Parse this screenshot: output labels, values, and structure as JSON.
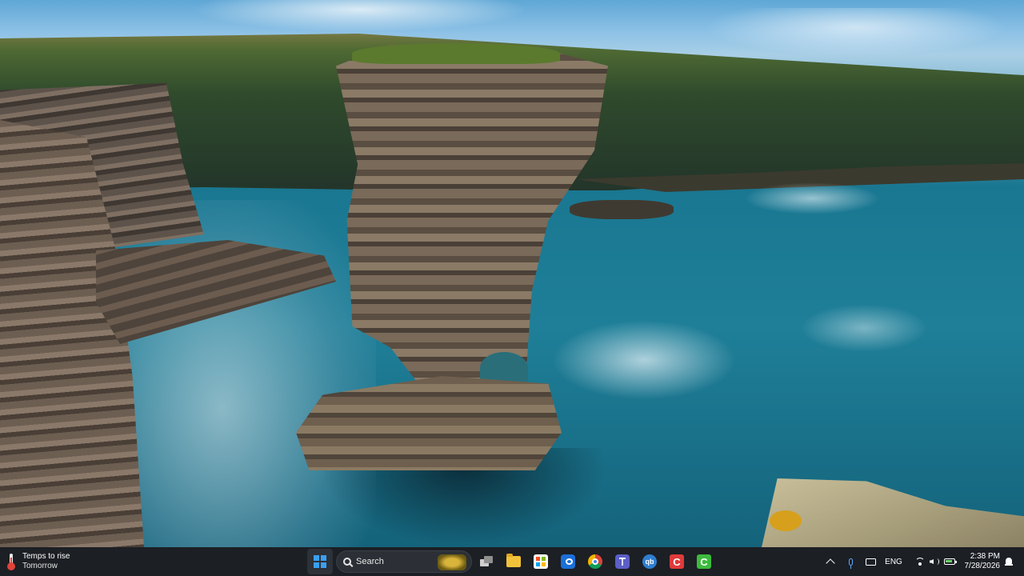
{
  "taskbar": {
    "weather": {
      "line1": "Temps to rise",
      "line2": "Tomorrow"
    },
    "search": {
      "label": "Search"
    },
    "language": "ENG",
    "clock": {
      "time": "2:38 PM",
      "date": "7/28/2026"
    },
    "apps": [
      {
        "icon": "windows-start-icon"
      },
      {
        "icon": "task-view-icon"
      },
      {
        "icon": "file-explorer-icon"
      },
      {
        "icon": "microsoft-store-icon"
      },
      {
        "icon": "outlook-icon"
      },
      {
        "icon": "chrome-icon"
      },
      {
        "icon": "teams-icon"
      },
      {
        "icon": "quickbooks-icon",
        "glyph": "qb"
      },
      {
        "icon": "app-c-red-icon",
        "glyph": "C"
      },
      {
        "icon": "app-c-green-icon",
        "glyph": "C"
      }
    ],
    "colors": {
      "taskbar_bg": "#1c1f24",
      "accent": "#3aa0f0"
    }
  }
}
